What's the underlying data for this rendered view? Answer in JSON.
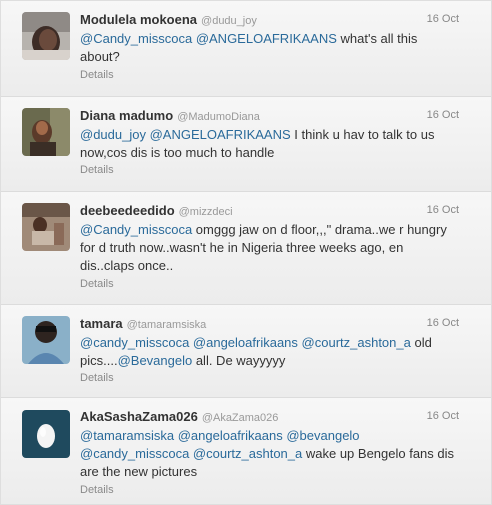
{
  "tweets": [
    {
      "name": "Modulela mokoena",
      "handle": "@dudu_joy",
      "time": "16 Oct",
      "segments": [
        {
          "text": "@Candy_misscoca",
          "link": true
        },
        {
          "text": " ",
          "link": false
        },
        {
          "text": "@ANGELOAFRIKAANS",
          "link": true
        },
        {
          "text": " what's all this about?",
          "link": false
        }
      ],
      "details": "Details",
      "avatar": "person-photo"
    },
    {
      "name": "Diana madumo",
      "handle": "@MadumoDiana",
      "time": "16 Oct",
      "segments": [
        {
          "text": "@dudu_joy",
          "link": true
        },
        {
          "text": " ",
          "link": false
        },
        {
          "text": "@ANGELOAFRIKAANS",
          "link": true
        },
        {
          "text": " I think u hav to talk to us now,cos dis is too much to handle",
          "link": false
        }
      ],
      "details": "Details",
      "avatar": "person-photo"
    },
    {
      "name": "deebeedeedido",
      "handle": "@mizzdeci",
      "time": "16 Oct",
      "segments": [
        {
          "text": "@Candy_misscoca",
          "link": true
        },
        {
          "text": " omggg jaw on d floor,,,\" drama..we r hungry for d truth now..wasn't he in Nigeria three weeks ago, en dis..claps once..",
          "link": false
        }
      ],
      "details": "Details",
      "avatar": "person-photo"
    },
    {
      "name": "tamara",
      "handle": "@tamaramsiska",
      "time": "16 Oct",
      "segments": [
        {
          "text": "@candy_misscoca",
          "link": true
        },
        {
          "text": " ",
          "link": false
        },
        {
          "text": "@angeloafrikaans",
          "link": true
        },
        {
          "text": " ",
          "link": false
        },
        {
          "text": "@courtz_ashton_a",
          "link": true
        },
        {
          "text": " old pics....",
          "link": false
        },
        {
          "text": "@Bevangelo",
          "link": true
        },
        {
          "text": " all. De wayyyyy",
          "link": false
        }
      ],
      "details": "Details",
      "avatar": "person-photo"
    },
    {
      "name": "AkaSashaZama026",
      "handle": "@AkaZama026",
      "time": "16 Oct",
      "segments": [
        {
          "text": "@tamaramsiska",
          "link": true
        },
        {
          "text": " ",
          "link": false
        },
        {
          "text": "@angeloafrikaans",
          "link": true
        },
        {
          "text": " ",
          "link": false
        },
        {
          "text": "@bevangelo",
          "link": true
        },
        {
          "text": " ",
          "link": false
        },
        {
          "text": "@candy_misscoca",
          "link": true
        },
        {
          "text": " ",
          "link": false
        },
        {
          "text": "@courtz_ashton_a",
          "link": true
        },
        {
          "text": " wake up Bengelo fans dis are the new pictures",
          "link": false
        }
      ],
      "details": "Details",
      "avatar": "egg-icon"
    }
  ]
}
